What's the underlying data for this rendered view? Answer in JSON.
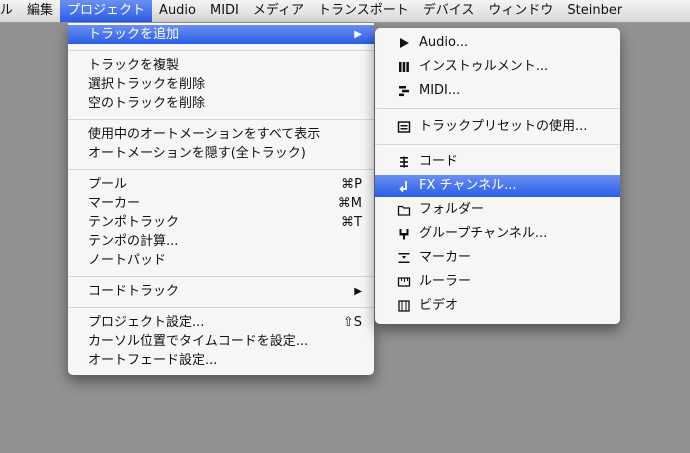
{
  "menubar": {
    "items": [
      "ル",
      "編集",
      "プロジェクト",
      "Audio",
      "MIDI",
      "メディア",
      "トランスポート",
      "デバイス",
      "ウィンドウ",
      "Steinber"
    ]
  },
  "main_menu": {
    "items": [
      {
        "label": "トラックを追加",
        "arrow": "▶"
      },
      {
        "label": "トラックを複製"
      },
      {
        "label": "選択トラックを削除"
      },
      {
        "label": "空のトラックを削除"
      },
      {
        "label": "使用中のオートメーションをすべて表示"
      },
      {
        "label": "オートメーションを隠す(全トラック)"
      },
      {
        "label": "プール",
        "shortcut": "⌘P"
      },
      {
        "label": "マーカー",
        "shortcut": "⌘M"
      },
      {
        "label": "テンポトラック",
        "shortcut": "⌘T"
      },
      {
        "label": "テンポの計算..."
      },
      {
        "label": "ノートパッド"
      },
      {
        "label": "コードトラック",
        "arrow": "▶"
      },
      {
        "label": "プロジェクト設定...",
        "shortcut": "⇧S"
      },
      {
        "label": "カーソル位置でタイムコードを設定..."
      },
      {
        "label": "オートフェード設定..."
      }
    ]
  },
  "submenu": {
    "items": [
      {
        "label": "Audio...",
        "icon": "play-triangle-icon"
      },
      {
        "label": "インストゥルメント...",
        "icon": "piano-keys-icon"
      },
      {
        "label": "MIDI...",
        "icon": "midi-bars-icon"
      },
      {
        "label": "トラックプリセットの使用...",
        "icon": "preset-list-icon"
      },
      {
        "label": "コード",
        "icon": "chord-icon"
      },
      {
        "label": "FX チャンネル...",
        "icon": "fx-channel-icon"
      },
      {
        "label": "フォルダー",
        "icon": "folder-icon"
      },
      {
        "label": "グループチャンネル...",
        "icon": "group-channel-icon"
      },
      {
        "label": "マーカー",
        "icon": "marker-icon"
      },
      {
        "label": "ルーラー",
        "icon": "ruler-icon"
      },
      {
        "label": "ビデオ",
        "icon": "video-icon"
      }
    ]
  }
}
